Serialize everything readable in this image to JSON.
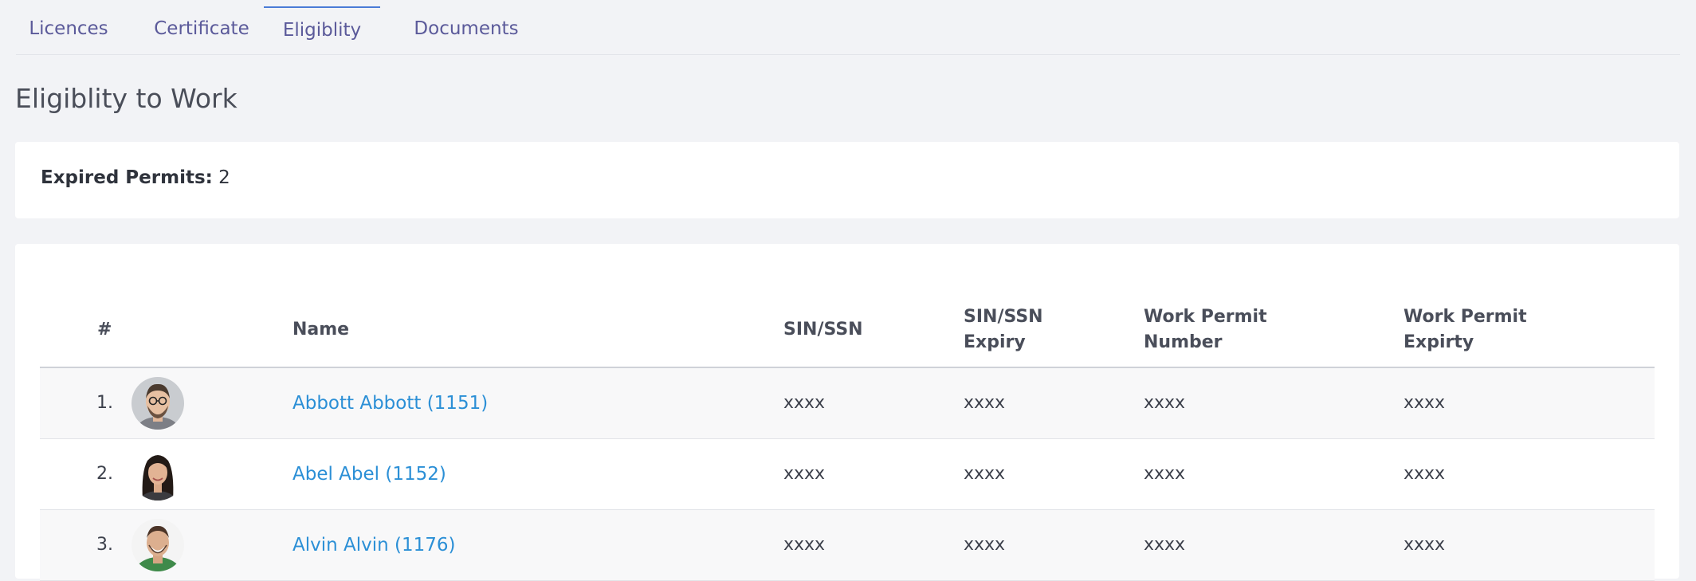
{
  "tabs": [
    {
      "label": "Licences"
    },
    {
      "label": "Certificate"
    },
    {
      "label": "Eligiblity"
    },
    {
      "label": "Documents"
    }
  ],
  "page_title": "Eligiblity to Work",
  "summary": {
    "label": "Expired Permits:",
    "value": "2"
  },
  "table": {
    "headers": {
      "num": "#",
      "name": "Name",
      "sin": "SIN/SSN",
      "sin_expiry_1": "SIN/SSN",
      "sin_expiry_2": "Expiry",
      "permit_number_1": "Work Permit",
      "permit_number_2": "Number",
      "permit_expiry_1": "Work Permit",
      "permit_expiry_2": "Expirty"
    },
    "rows": [
      {
        "num": "1.",
        "name": "Abbott Abbott (1151)",
        "sin": "xxxx",
        "sin_expiry": "xxxx",
        "permit_number": "xxxx",
        "permit_expiry": "xxxx"
      },
      {
        "num": "2.",
        "name": "Abel Abel (1152)",
        "sin": "xxxx",
        "sin_expiry": "xxxx",
        "permit_number": "xxxx",
        "permit_expiry": "xxxx"
      },
      {
        "num": "3.",
        "name": "Alvin Alvin (1176)",
        "sin": "xxxx",
        "sin_expiry": "xxxx",
        "permit_number": "xxxx",
        "permit_expiry": "xxxx"
      }
    ]
  },
  "colors": {
    "tab_text": "#5b5a9a",
    "active_tab_border": "#4a7bd6",
    "link": "#2b8fd6",
    "background": "#f2f3f6"
  }
}
